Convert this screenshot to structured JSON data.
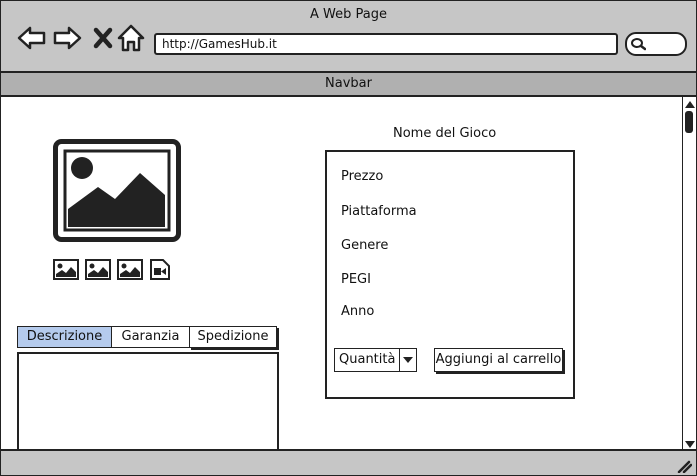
{
  "window": {
    "title": "A Web Page"
  },
  "browser": {
    "url": "http://GamesHub.it",
    "buttons": {
      "back_icon": "arrow-left-icon",
      "forward_icon": "arrow-right-icon",
      "stop_icon": "close-icon",
      "home_icon": "home-icon"
    },
    "search_icon": "search-icon"
  },
  "navbar": {
    "label": "Navbar"
  },
  "product": {
    "title": "Nome del Gioco",
    "fields": [
      "Prezzo",
      "Piattaforma",
      "Genere",
      "PEGI",
      "Anno"
    ],
    "quantity_label": "Quantità",
    "add_to_cart_label": "Aggiungi al carrello"
  },
  "gallery": {
    "main_icon": "image-icon",
    "thumbnails": [
      "image-icon",
      "image-icon",
      "image-icon",
      "video-icon"
    ]
  },
  "tabs": {
    "items": [
      "Descrizione",
      "Garanzia",
      "Spedizione"
    ],
    "active": "Descrizione",
    "active_color": "#b5cbed"
  }
}
